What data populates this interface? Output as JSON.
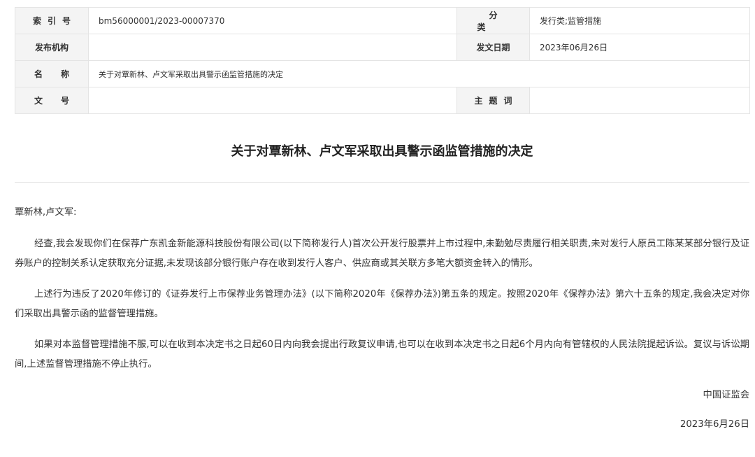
{
  "meta": {
    "index_label": "索引号",
    "index_value": "bm56000001/2023-00007370",
    "category_label": "分类",
    "category_value": "发行类;监管措施",
    "publisher_label": "发布机构",
    "publisher_value": "",
    "date_label": "发文日期",
    "date_value": "2023年06月26日",
    "name_label": "名称",
    "name_value": "关于对覃新林、卢文军采取出具警示函监管措施的决定",
    "docno_label": "文号",
    "docno_value": "",
    "keywords_label": "主题词",
    "keywords_value": ""
  },
  "document": {
    "title": "关于对覃新林、卢文军采取出具警示函监管措施的决定",
    "salutation": "覃新林,卢文军:",
    "paragraphs": [
      "经查,我会发现你们在保荐广东凯金新能源科技股份有限公司(以下简称发行人)首次公开发行股票并上市过程中,未勤勉尽责履行相关职责,未对发行人原员工陈某某部分银行及证券账户的控制关系认定获取充分证据,未发现该部分银行账户存在收到发行人客户、供应商或其关联方多笔大额资金转入的情形。",
      "上述行为违反了2020年修订的《证券发行上市保荐业务管理办法》(以下简称2020年《保荐办法》)第五条的规定。按照2020年《保荐办法》第六十五条的规定,我会决定对你们采取出具警示函的监督管理措施。",
      "如果对本监督管理措施不服,可以在收到本决定书之日起60日内向我会提出行政复议申请,也可以在收到本决定书之日起6个月内向有管辖权的人民法院提起诉讼。复议与诉讼期间,上述监督管理措施不停止执行。"
    ],
    "signature": "中国证监会",
    "date": "2023年6月26日"
  }
}
